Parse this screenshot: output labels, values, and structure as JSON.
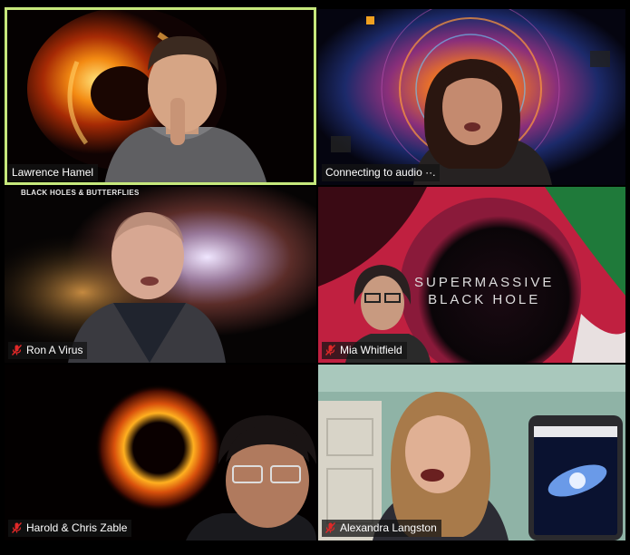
{
  "participants": [
    {
      "name": "Lawrence Hamel",
      "muted": false,
      "active_speaker": true
    },
    {
      "name": "Connecting to audio ··.",
      "muted": false,
      "active_speaker": false
    },
    {
      "name": "Ron A Virus",
      "muted": true,
      "active_speaker": false,
      "background_banner": "BLACK HOLES & BUTTERFLIES"
    },
    {
      "name": "Mia Whitfield",
      "muted": true,
      "active_speaker": false,
      "background_text_line1": "SUPERMASSIVE",
      "background_text_line2": "BLACK HOLE"
    },
    {
      "name": "Harold & Chris Zable",
      "muted": true,
      "active_speaker": false
    },
    {
      "name": "Alexandra Langston",
      "muted": true,
      "active_speaker": false
    }
  ],
  "colors": {
    "active_border": "#c6e87c",
    "mute_icon": "#e02828"
  },
  "icons": {
    "muted": "microphone-muted-icon"
  }
}
